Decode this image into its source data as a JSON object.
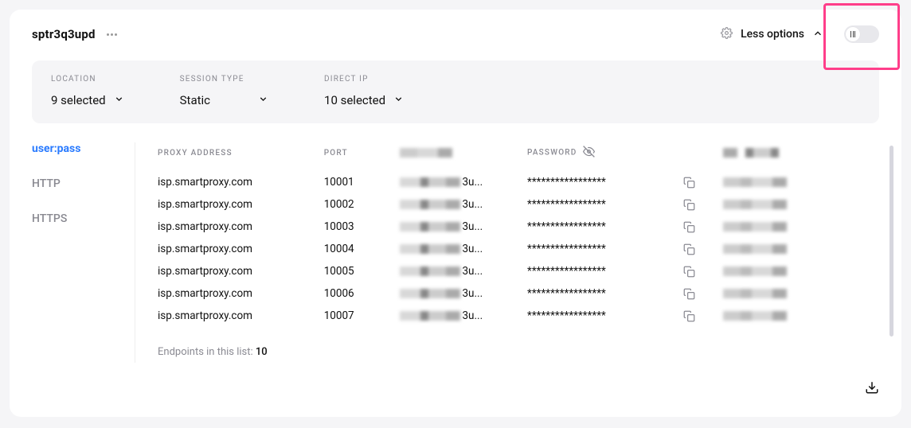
{
  "header": {
    "title": "sptr3q3upd",
    "less_options": "Less options"
  },
  "filters": {
    "location": {
      "label": "LOCATION",
      "value": "9 selected"
    },
    "session": {
      "label": "SESSION TYPE",
      "value": "Static"
    },
    "directip": {
      "label": "DIRECT IP",
      "value": "10 selected"
    }
  },
  "sidebar": {
    "items": [
      {
        "label": "user:pass",
        "active": true
      },
      {
        "label": "HTTP"
      },
      {
        "label": "HTTPS"
      }
    ]
  },
  "table": {
    "headers": {
      "proxy_address": "PROXY ADDRESS",
      "port": "PORT",
      "password": "PASSWORD"
    },
    "masked_password": "*****************",
    "user_suffix": "3u...",
    "rows": [
      {
        "addr": "isp.smartproxy.com",
        "port": "10001"
      },
      {
        "addr": "isp.smartproxy.com",
        "port": "10002"
      },
      {
        "addr": "isp.smartproxy.com",
        "port": "10003"
      },
      {
        "addr": "isp.smartproxy.com",
        "port": "10004"
      },
      {
        "addr": "isp.smartproxy.com",
        "port": "10005"
      },
      {
        "addr": "isp.smartproxy.com",
        "port": "10006"
      },
      {
        "addr": "isp.smartproxy.com",
        "port": "10007"
      }
    ],
    "footer_prefix": "Endpoints in this list: ",
    "footer_count": "10"
  }
}
